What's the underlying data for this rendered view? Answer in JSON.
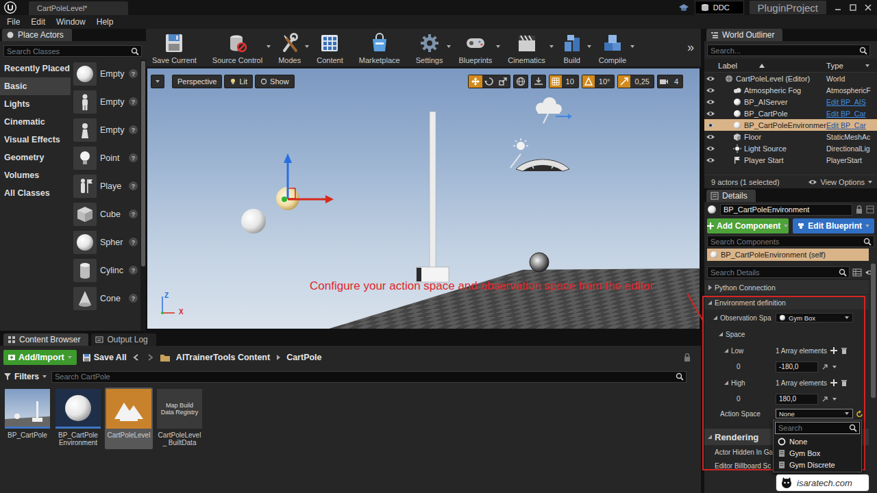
{
  "window": {
    "tab": "CartPoleLevel*",
    "ddc": "DDC",
    "project": "PluginProject"
  },
  "menu": [
    "File",
    "Edit",
    "Window",
    "Help"
  ],
  "place_actors": {
    "title": "Place Actors",
    "search": {
      "placeholder": "Search Classes"
    },
    "categories": [
      {
        "label": "Recently Placed",
        "selected": false
      },
      {
        "label": "Basic",
        "selected": true
      },
      {
        "label": "Lights",
        "selected": false
      },
      {
        "label": "Cinematic",
        "selected": false
      },
      {
        "label": "Visual Effects",
        "selected": false
      },
      {
        "label": "Geometry",
        "selected": false
      },
      {
        "label": "Volumes",
        "selected": false
      },
      {
        "label": "All Classes",
        "selected": false
      }
    ],
    "items": [
      {
        "label": "Empty",
        "kind": "sphere"
      },
      {
        "label": "Empty",
        "kind": "character"
      },
      {
        "label": "Empty",
        "kind": "pawn"
      },
      {
        "label": "Point",
        "kind": "light"
      },
      {
        "label": "Playe",
        "kind": "player"
      },
      {
        "label": "Cube",
        "kind": "cube"
      },
      {
        "label": "Spher",
        "kind": "sphere"
      },
      {
        "label": "Cylinc",
        "kind": "cylinder"
      },
      {
        "label": "Cone",
        "kind": "cone"
      }
    ],
    "help": "?"
  },
  "toolbar": [
    {
      "label": "Save Current",
      "kind": "save",
      "menu": false
    },
    {
      "label": "Source Control",
      "kind": "source",
      "menu": true
    },
    {
      "label": "Modes",
      "kind": "modes",
      "menu": true
    },
    {
      "label": "Content",
      "kind": "content",
      "menu": false
    },
    {
      "label": "Marketplace",
      "kind": "market",
      "menu": false
    },
    {
      "label": "Settings",
      "kind": "settings",
      "menu": true
    },
    {
      "label": "Blueprints",
      "kind": "blueprints",
      "menu": true
    },
    {
      "label": "Cinematics",
      "kind": "cinematics",
      "menu": true
    },
    {
      "label": "Build",
      "kind": "build",
      "menu": true
    },
    {
      "label": "Compile",
      "kind": "compile",
      "menu": true
    }
  ],
  "toolbar_more": "»",
  "viewport": {
    "view_buttons": [
      "Perspective",
      "Lit",
      "Show"
    ],
    "transform_tools": [
      {
        "kind": "move",
        "selected": true
      },
      {
        "kind": "rotate",
        "selected": false
      },
      {
        "kind": "scale",
        "selected": false
      }
    ],
    "snaps": [
      {
        "value": "10",
        "kind": "grid",
        "active": true
      },
      {
        "value": "10°",
        "kind": "angle",
        "active": true
      },
      {
        "value": "0,25",
        "kind": "scale",
        "active": true
      },
      {
        "value": "4",
        "kind": "camera",
        "active": false
      }
    ],
    "axes": [
      "Z",
      "X"
    ],
    "annotation": "Configure your action space and observation space from the editor"
  },
  "content_browser": {
    "tabs": [
      {
        "label": "Content Browser",
        "selected": true
      },
      {
        "label": "Output Log",
        "selected": false
      }
    ],
    "add_import": "Add/Import",
    "save_all": "Save All",
    "path": [
      "AITrainerTools Content",
      "CartPole"
    ],
    "filters": "Filters",
    "search": {
      "placeholder": "Search CartPole"
    },
    "assets": [
      {
        "label": "BP_CartPole",
        "kind": "blueprint",
        "selected": false
      },
      {
        "label": "BP_CartPole Environment",
        "kind": "environment",
        "selected": false
      },
      {
        "label": "CartPoleLevel",
        "kind": "level",
        "selected": true
      },
      {
        "label": "CartPoleLevel_ BuiltData",
        "kind": "data",
        "thumb": "Map Build Data Registry",
        "selected": false
      }
    ]
  },
  "outliner": {
    "title": "World Outliner",
    "search": {
      "placeholder": "Search..."
    },
    "columns": [
      "Label",
      "Type"
    ],
    "rows": [
      {
        "label": "CartPoleLevel (Editor)",
        "type": "World",
        "kind": "world",
        "depth": 0,
        "link": false,
        "selected": false
      },
      {
        "label": "Atmospheric Fog",
        "type": "AtmosphericF",
        "kind": "fog",
        "depth": 1,
        "link": false,
        "selected": false
      },
      {
        "label": "BP_AIServer",
        "type": "Edit BP_AIS",
        "kind": "blueprint",
        "depth": 1,
        "link": true,
        "selected": false
      },
      {
        "label": "BP_CartPole",
        "type": "Edit BP_Car",
        "kind": "blueprint",
        "depth": 1,
        "link": true,
        "selected": false
      },
      {
        "label": "BP_CartPoleEnvironmer",
        "type": "Edit BP_Car",
        "kind": "blueprint",
        "depth": 1,
        "link": true,
        "selected": true
      },
      {
        "label": "Floor",
        "type": "StaticMeshAc",
        "kind": "mesh",
        "depth": 1,
        "link": false,
        "selected": false
      },
      {
        "label": "Light Source",
        "type": "DirectionalLig",
        "kind": "light",
        "depth": 1,
        "link": false,
        "selected": false
      },
      {
        "label": "Player Start",
        "type": "PlayerStart",
        "kind": "start",
        "depth": 1,
        "link": false,
        "selected": false
      }
    ],
    "footer": "9 actors (1 selected)",
    "view_options": "View Options"
  },
  "details": {
    "title": "Details",
    "name": "BP_CartPoleEnvironment",
    "add_component": "Add Component",
    "edit_blueprint": "Edit Blueprint",
    "search_components": {
      "placeholder": "Search Components"
    },
    "self": "BP_CartPoleEnvironment (self)",
    "search_details": {
      "placeholder": "Search Details"
    },
    "properties": [
      {
        "kind": "category",
        "label": "Python Connection",
        "depth": 0,
        "expanded": false
      },
      {
        "kind": "category",
        "label": "Environment definition",
        "depth": 0,
        "expanded": true
      },
      {
        "kind": "enum",
        "label": "Observation Spa",
        "value": "Gym Box",
        "value_icon": true,
        "depth": 1,
        "expanded": true
      },
      {
        "kind": "group",
        "label": "Space",
        "depth": 2,
        "expanded": true
      },
      {
        "kind": "array",
        "label": "Low",
        "value": "1 Array elements",
        "depth": 3,
        "expanded": true
      },
      {
        "kind": "number",
        "label": "0",
        "value": "-180,0",
        "depth": 4
      },
      {
        "kind": "array",
        "label": "High",
        "value": "1 Array elements",
        "depth": 3,
        "expanded": true
      },
      {
        "kind": "number",
        "label": "0",
        "value": "180,0",
        "depth": 4
      },
      {
        "kind": "enum",
        "label": "Action Space",
        "value": "None",
        "value_icon": false,
        "depth": 1,
        "open": true,
        "modified": true
      },
      {
        "kind": "section",
        "label": "Rendering",
        "depth": 0,
        "expanded": true
      },
      {
        "kind": "text",
        "label": "Actor Hidden In Ga",
        "depth": 0
      },
      {
        "kind": "text",
        "label": "Editor Billboard Sc",
        "depth": 0
      }
    ]
  },
  "dropdown": {
    "search": {
      "placeholder": "Search"
    },
    "options": [
      {
        "label": "None",
        "kind": "none",
        "selected": false
      },
      {
        "label": "Gym Box",
        "kind": "class",
        "selected": false
      },
      {
        "label": "Gym Discrete",
        "kind": "class",
        "selected": false
      }
    ]
  },
  "watermark": "isaratech.com"
}
